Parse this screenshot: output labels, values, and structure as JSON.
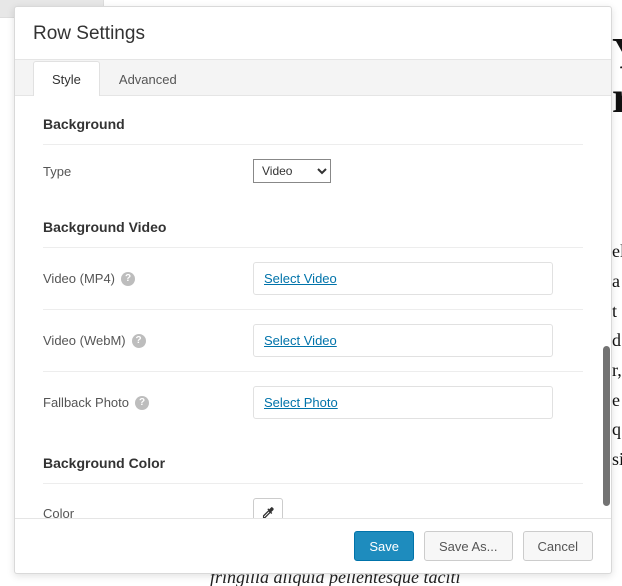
{
  "backdrop": {
    "big1": "Y",
    "big2": "ru",
    "lines": [
      "el",
      "a",
      "t",
      "d",
      "",
      "r,",
      "e",
      "q",
      "si"
    ],
    "bottom": "fringilla aliquid pellentesque taciti"
  },
  "modal": {
    "title": "Row Settings",
    "tabs": {
      "style": "Style",
      "advanced": "Advanced"
    },
    "sections": {
      "background": {
        "heading": "Background",
        "type_label": "Type",
        "type_value": "Video"
      },
      "background_video": {
        "heading": "Background Video",
        "mp4_label": "Video (MP4)",
        "mp4_link": "Select Video",
        "webm_label": "Video (WebM)",
        "webm_link": "Select Video",
        "fallback_label": "Fallback Photo",
        "fallback_link": "Select Photo"
      },
      "background_color": {
        "heading": "Background Color",
        "color_label": "Color"
      }
    },
    "footer": {
      "save": "Save",
      "save_as": "Save As...",
      "cancel": "Cancel"
    },
    "help_glyph": "?"
  }
}
